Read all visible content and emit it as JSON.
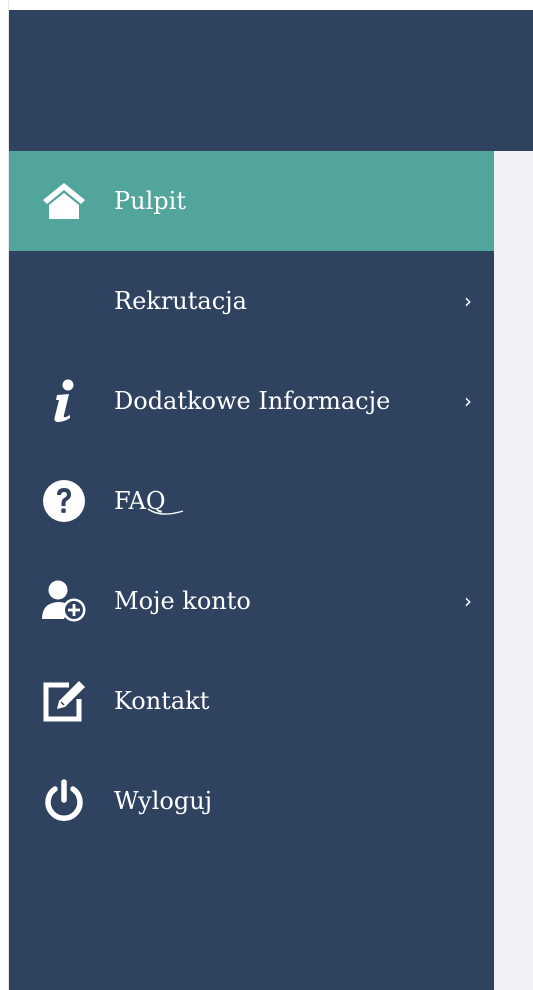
{
  "sidebar": {
    "items": [
      {
        "label": "Pulpit",
        "icon": "home-icon",
        "active": true,
        "has_submenu": false
      },
      {
        "label": "Rekrutacja",
        "icon": "",
        "active": false,
        "has_submenu": true
      },
      {
        "label": "Dodatkowe Informacje",
        "icon": "info-icon",
        "active": false,
        "has_submenu": true
      },
      {
        "label": "FAQ",
        "icon": "question-circle-icon",
        "active": false,
        "has_submenu": false
      },
      {
        "label": "Moje konto",
        "icon": "user-add-icon",
        "active": false,
        "has_submenu": true
      },
      {
        "label": "Kontakt",
        "icon": "edit-icon",
        "active": false,
        "has_submenu": false
      },
      {
        "label": "Wyloguj",
        "icon": "power-icon",
        "active": false,
        "has_submenu": false
      }
    ],
    "chevron": "›"
  },
  "colors": {
    "sidebar_bg": "#2f4361",
    "active_bg": "#52a59a",
    "content_bg": "#f2f1f6",
    "text": "#ffffff"
  }
}
